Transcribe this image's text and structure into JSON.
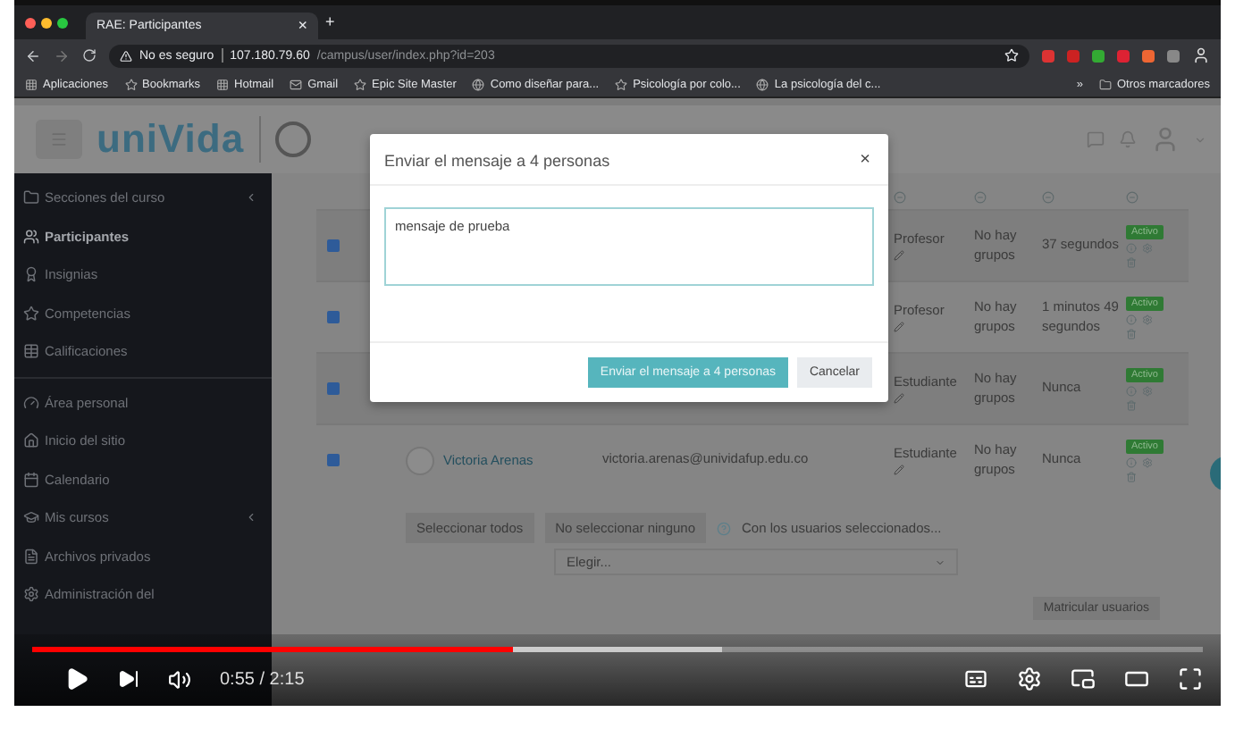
{
  "browser": {
    "tab_title": "RAE: Participantes",
    "tab_close": "×",
    "new_tab": "+",
    "security": "No es seguro",
    "url_host": "107.180.79.60",
    "url_path": "/campus/user/index.php?id=203",
    "bookmarks": [
      {
        "label": "Aplicaciones"
      },
      {
        "label": "Bookmarks"
      },
      {
        "label": "Hotmail"
      },
      {
        "label": "Gmail"
      },
      {
        "label": "Epic Site Master"
      },
      {
        "label": "Como diseñar para..."
      },
      {
        "label": "Psicología por colo..."
      },
      {
        "label": "La psicología del c..."
      }
    ],
    "more": "»",
    "other_bookmarks": "Otros marcadores"
  },
  "site": {
    "logo": "uniVida"
  },
  "sidebar": {
    "sections": [
      [
        {
          "label": "Secciones del curso",
          "has_submenu": true,
          "selected": false
        },
        {
          "label": "Participantes",
          "has_submenu": false,
          "selected": true
        },
        {
          "label": "Insignias",
          "has_submenu": false,
          "selected": false
        },
        {
          "label": "Competencias",
          "has_submenu": false,
          "selected": false
        },
        {
          "label": "Calificaciones",
          "has_submenu": false,
          "selected": false
        }
      ],
      [
        {
          "label": "Área personal",
          "has_submenu": false,
          "selected": false
        },
        {
          "label": "Inicio del sitio",
          "has_submenu": false,
          "selected": false
        },
        {
          "label": "Calendario",
          "has_submenu": false,
          "selected": false
        },
        {
          "label": "Mis cursos",
          "has_submenu": true,
          "selected": false
        },
        {
          "label": "Archivos privados",
          "has_submenu": false,
          "selected": false
        },
        {
          "label": "Administración del",
          "has_submenu": false,
          "selected": false
        }
      ]
    ]
  },
  "table": {
    "rows": [
      {
        "checked": true,
        "role": "Profesor",
        "groups": "No hay grupos",
        "last_access": "37 segundos",
        "status": "Activo"
      },
      {
        "checked": true,
        "role": "Profesor",
        "groups": "No hay grupos",
        "last_access": "1 minutos 49 segundos",
        "status": "Activo"
      },
      {
        "checked": true,
        "role": "Estudiante",
        "groups": "No hay grupos",
        "last_access": "Nunca",
        "status": "Activo"
      },
      {
        "checked": true,
        "name": "Victoria Arenas",
        "email": "victoria.arenas@unividafup.edu.co",
        "role": "Estudiante",
        "groups": "No hay grupos",
        "last_access": "Nunca",
        "status": "Activo"
      }
    ]
  },
  "bulk_actions": {
    "buttons": [
      "Seleccionar todos",
      "No seleccionar ninguno"
    ],
    "with_selected": "Con los usuarios seleccionados...",
    "select": {
      "value": "Elegir..."
    }
  },
  "enrol_button": "Matricular usuarios",
  "modal": {
    "title": "Enviar el mensaje a 4 personas",
    "close": "×",
    "message": "mensaje de prueba",
    "send": "Enviar el mensaje a 4 personas",
    "cancel": "Cancelar"
  },
  "player": {
    "progress": {
      "level": 0.41
    },
    "buffer": {
      "level": 0.59
    },
    "time": "0:55 / 2:15"
  }
}
